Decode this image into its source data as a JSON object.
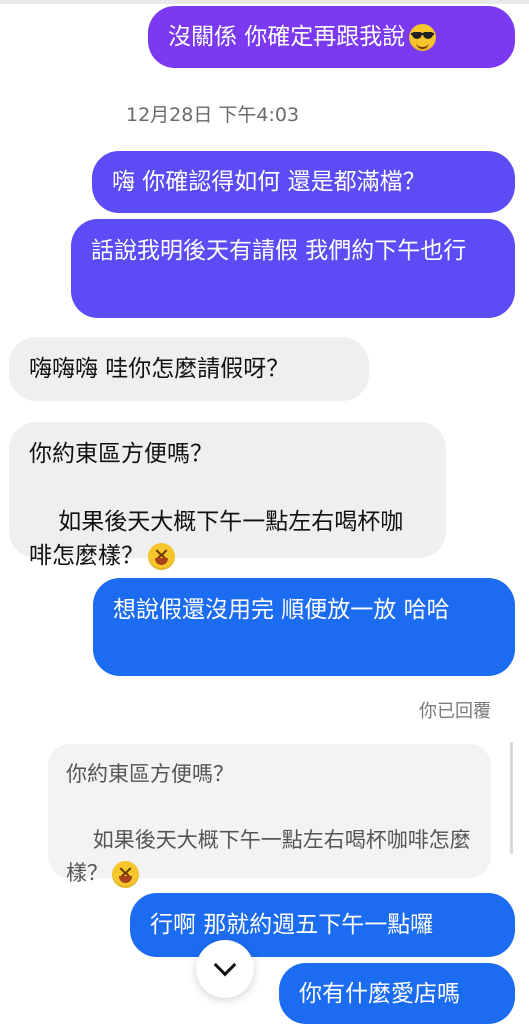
{
  "messages": {
    "m1": "沒關係 你確定再跟我說",
    "m2": "嗨 你確認得如何 還是都滿檔？",
    "m3": "話說我明後天有請假 我們約下午也行",
    "m4": "嗨嗨嗨 哇你怎麼請假呀？",
    "m5_line1": "你約東區方便嗎？",
    "m5_line2": "如果後天大概下午一點左右喝杯咖啡怎麼樣？",
    "m6": "想說假還沒用完 順便放一放 哈哈",
    "quote_line1": "你約東區方便嗎？",
    "quote_line2": "如果後天大概下午一點左右喝杯咖啡怎麼樣？",
    "m7": "行啊 那就約週五下午一點囉",
    "m8": "你有什麼愛店嗎"
  },
  "timestamp": "12月28日 下午4:03",
  "status": {
    "replied_label": "你已回覆"
  },
  "icons": {
    "sunglasses": "smiling-face-with-sunglasses-icon",
    "laughing": "grinning-squinting-face-icon",
    "scroll_down": "chevron-down-icon"
  },
  "colors": {
    "outgoing_purple": "#7b3af2",
    "outgoing_violet": "#5b4cf5",
    "outgoing_blue": "#1c6cf2",
    "incoming_gray": "#efefef"
  }
}
